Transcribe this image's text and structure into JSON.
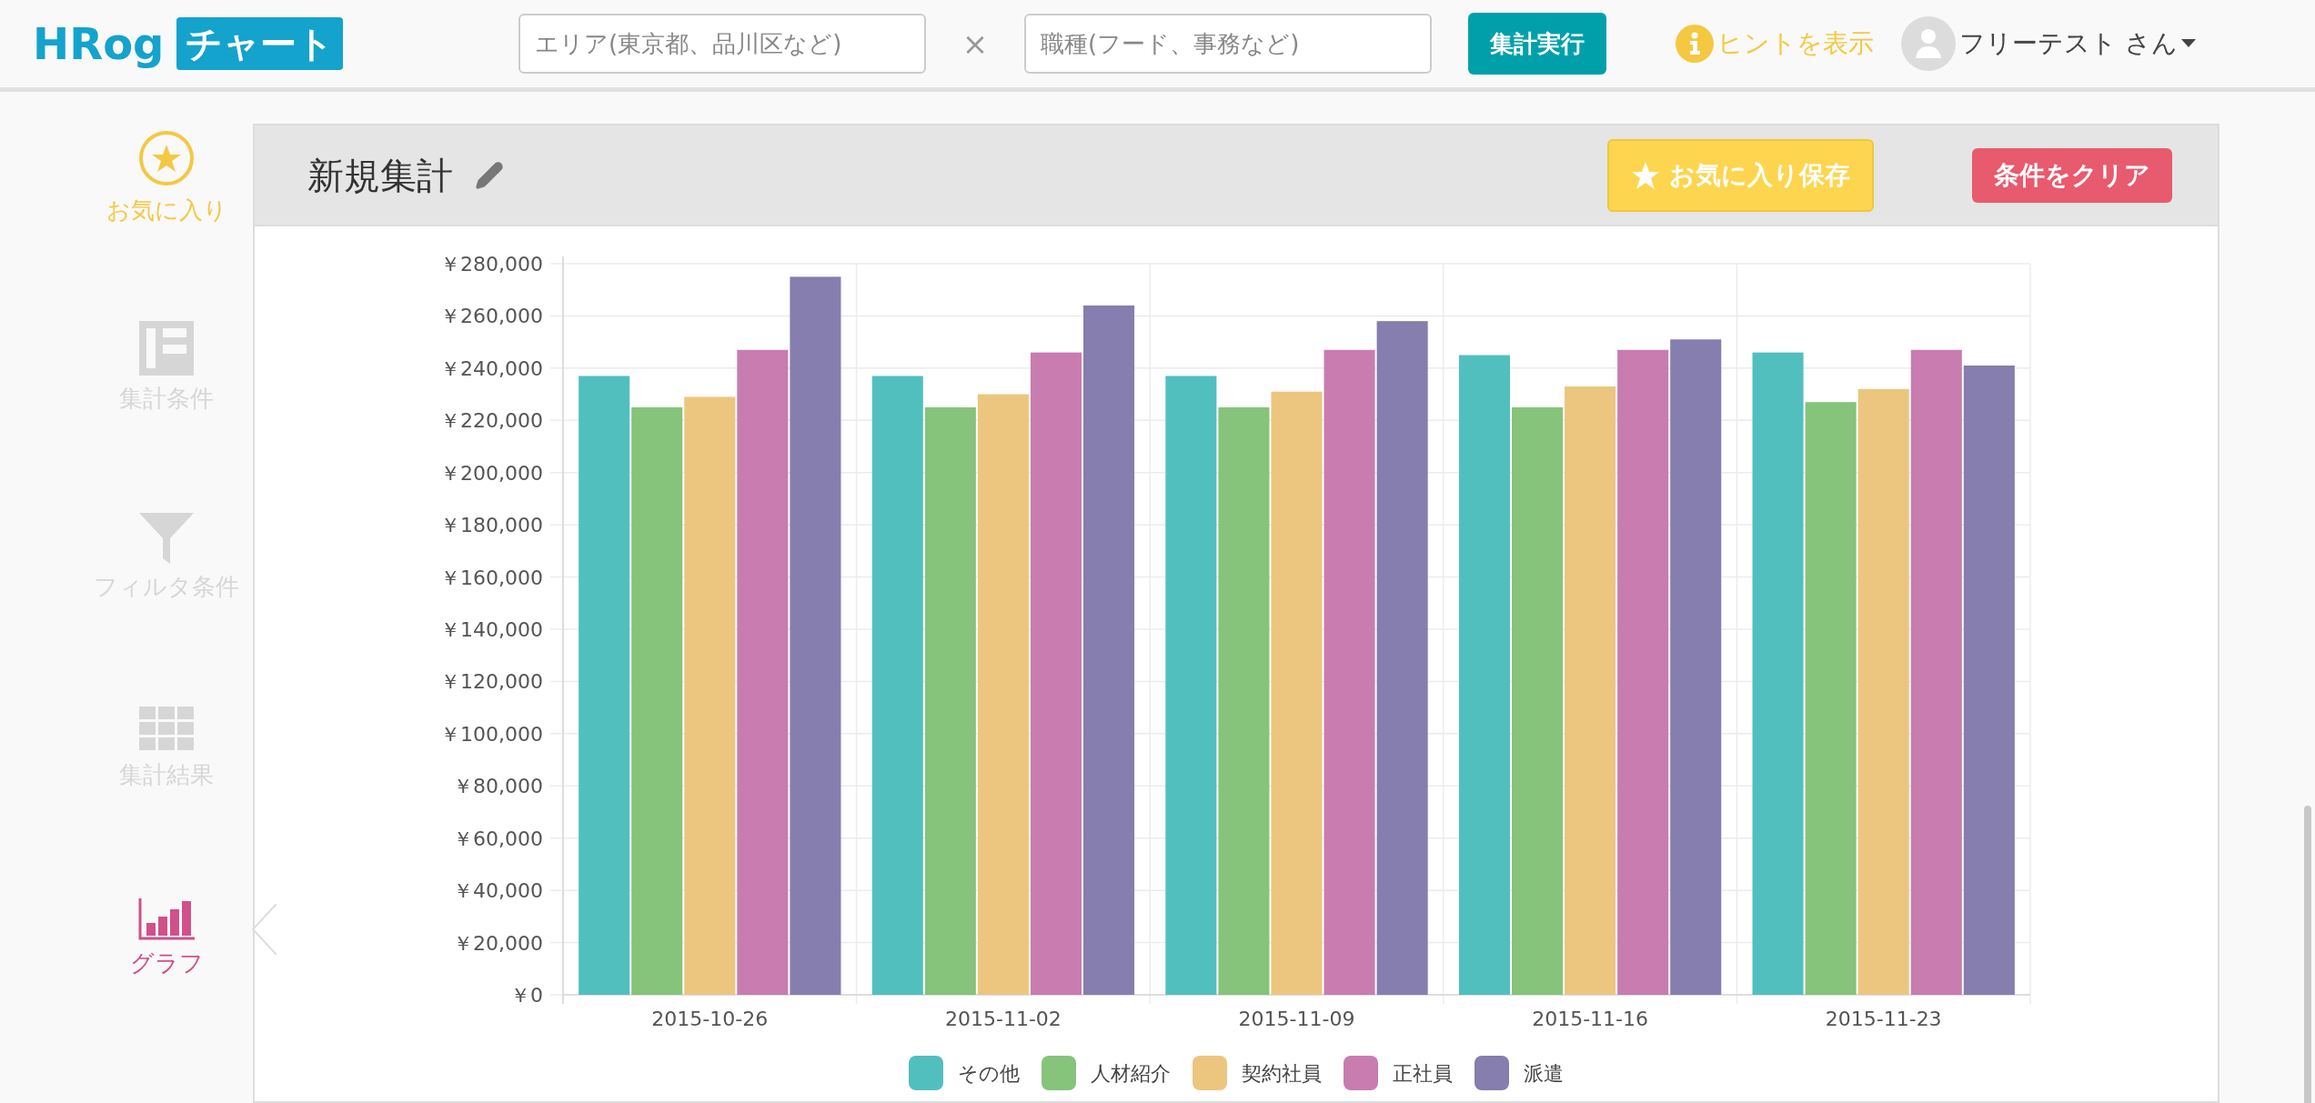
{
  "header": {
    "logo": {
      "text": "HRog",
      "badge": "チャート"
    },
    "area_field": {
      "placeholder": "エリア(東京都、品川区など)"
    },
    "separator": "×",
    "job_field": {
      "placeholder": "職種(フード、事務など)"
    },
    "run_button": "集計実行",
    "hint_link": "ヒントを表示",
    "user": {
      "name": "フリーテスト さん"
    }
  },
  "sidebar": {
    "items": [
      {
        "kind": "favorite",
        "label": "お気に入り",
        "selected": false
      },
      {
        "kind": "conditions",
        "label": "集計条件",
        "selected": false
      },
      {
        "kind": "filter",
        "label": "フィルタ条件",
        "selected": false
      },
      {
        "kind": "results",
        "label": "集計結果",
        "selected": false
      },
      {
        "kind": "graph",
        "label": "グラフ",
        "selected": true
      }
    ]
  },
  "panel": {
    "title": "新規集計",
    "favorite_button": "お気に入り保存",
    "clear_button": "条件をクリア",
    "chart_data": {
      "type": "bar",
      "categories": [
        "2015-10-26",
        "2015-11-02",
        "2015-11-09",
        "2015-11-16",
        "2015-11-23"
      ],
      "series": [
        {
          "name": "その他",
          "color": "#52bfbf",
          "values": [
            237000,
            237000,
            237000,
            245000,
            246000
          ]
        },
        {
          "name": "人材紹介",
          "color": "#86c37b",
          "values": [
            225000,
            225000,
            225000,
            225000,
            227000
          ]
        },
        {
          "name": "契約社員",
          "color": "#ecc67e",
          "values": [
            229000,
            230000,
            231000,
            233000,
            232000
          ]
        },
        {
          "name": "正社員",
          "color": "#c87cb0",
          "values": [
            247000,
            246000,
            247000,
            247000,
            247000
          ]
        },
        {
          "name": "派遣",
          "color": "#857eae",
          "values": [
            275000,
            264000,
            258000,
            251000,
            241000
          ]
        }
      ],
      "ylim": [
        0,
        280000
      ],
      "grid": true,
      "yticks": [
        {
          "value": 0,
          "label": "￥0"
        },
        {
          "value": 20000,
          "label": "￥20,000"
        },
        {
          "value": 40000,
          "label": "￥40,000"
        },
        {
          "value": 60000,
          "label": "￥60,000"
        },
        {
          "value": 80000,
          "label": "￥80,000"
        },
        {
          "value": 100000,
          "label": "￥100,000"
        },
        {
          "value": 120000,
          "label": "￥120,000"
        },
        {
          "value": 140000,
          "label": "￥140,000"
        },
        {
          "value": 160000,
          "label": "￥160,000"
        },
        {
          "value": 180000,
          "label": "￥180,000"
        },
        {
          "value": 200000,
          "label": "￥200,000"
        },
        {
          "value": 220000,
          "label": "￥220,000"
        },
        {
          "value": 240000,
          "label": "￥240,000"
        },
        {
          "value": 260000,
          "label": "￥260,000"
        },
        {
          "value": 280000,
          "label": "￥280,000"
        }
      ]
    }
  }
}
